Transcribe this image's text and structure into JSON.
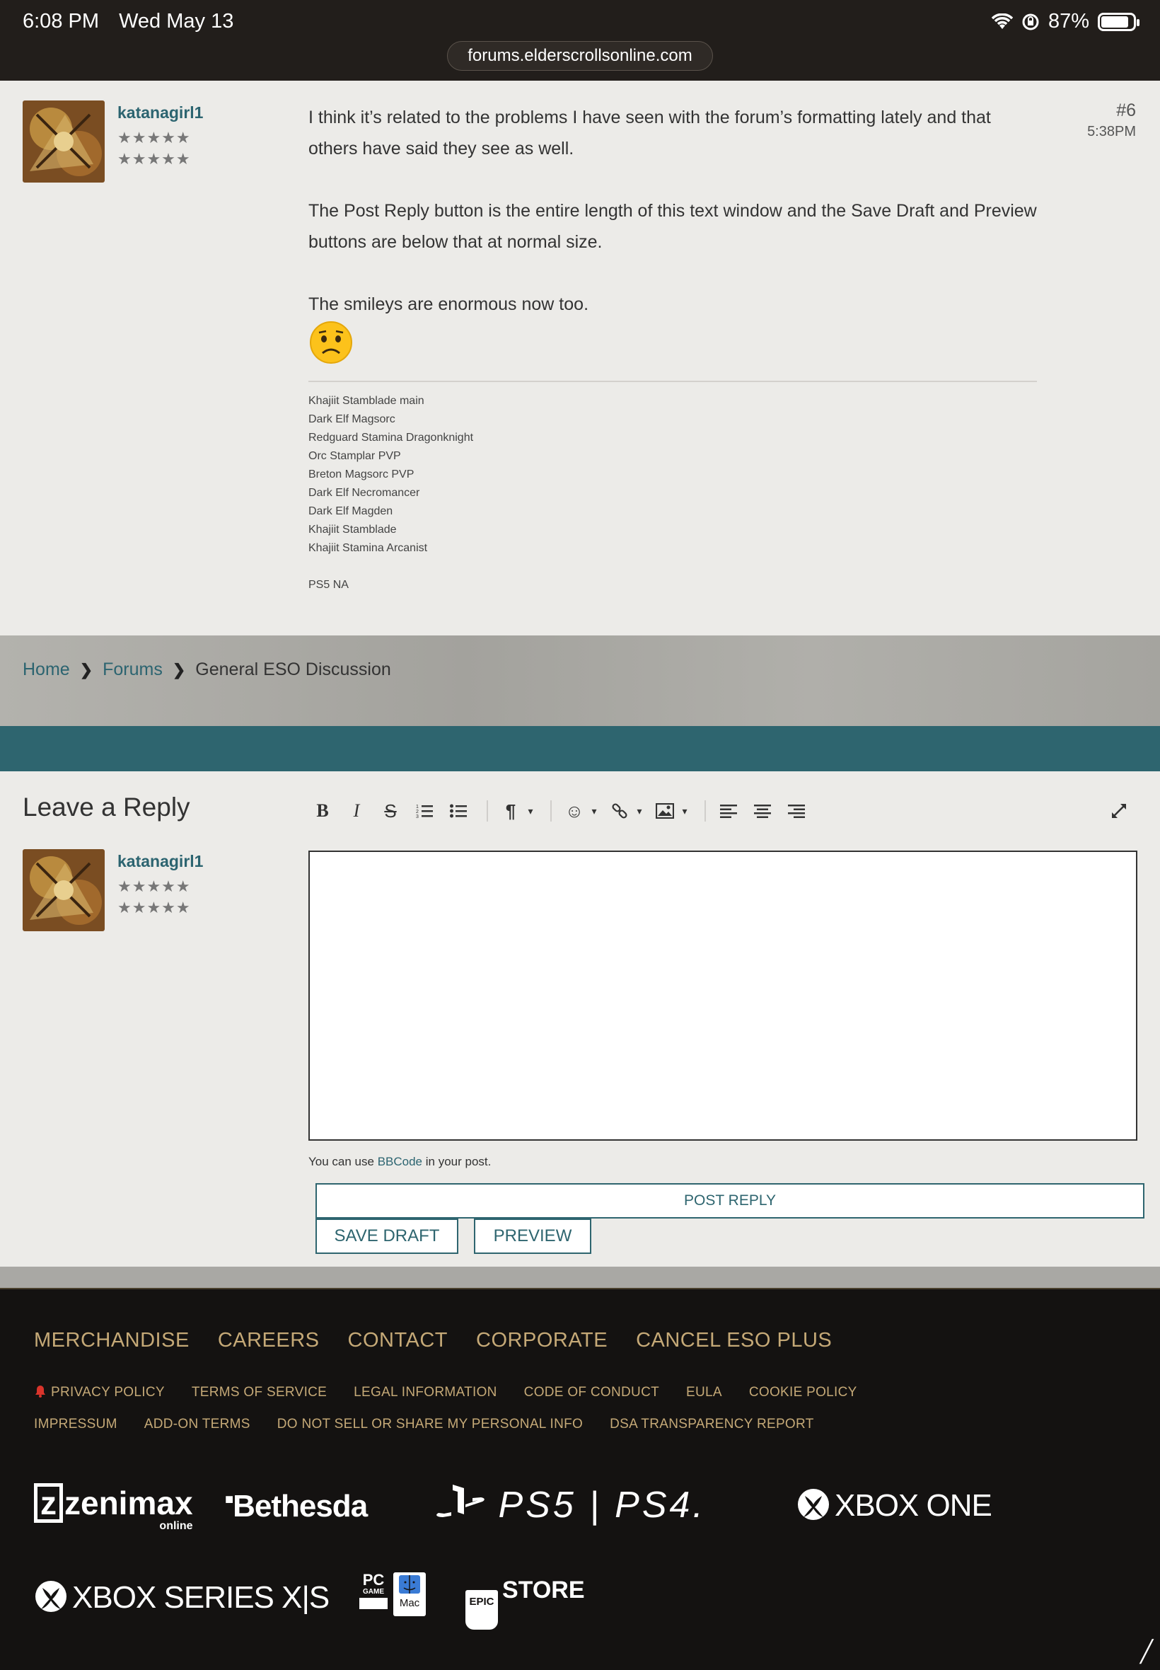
{
  "status_bar": {
    "time": "6:08 PM",
    "date": "Wed May 13",
    "battery": "87%",
    "url": "forums.elderscrollsonline.com",
    "battery_level": 0.87
  },
  "post": {
    "username": "katanagirl1",
    "stars_row1": "★★★★★",
    "stars_row2": "★★★★★",
    "number": "#6",
    "time": "5:38PM",
    "paragraphs": [
      "I think it’s related to the problems I have seen with the forum’s formatting lately and that others have said they see as well.",
      "The Post Reply button is the entire length of this text window and the Save Draft and Preview buttons are below that at normal size.",
      "The smileys are enormous now too."
    ],
    "signature": [
      "Khajiit Stamblade main",
      "Dark Elf Magsorc",
      "Redguard Stamina Dragonknight",
      "Orc Stamplar PVP",
      "Breton Magsorc PVP",
      "Dark Elf Necromancer",
      "Dark Elf Magden",
      "Khajiit Stamblade",
      "Khajiit Stamina Arcanist"
    ],
    "signature_platform": "PS5 NA"
  },
  "breadcrumb": {
    "home": "Home",
    "forums": "Forums",
    "current": "General ESO Discussion"
  },
  "reply": {
    "title": "Leave a Reply",
    "username": "katanagirl1",
    "stars_row1": "★★★★★",
    "stars_row2": "★★★★★",
    "hint_prefix": "You can use ",
    "hint_link": "BBCode",
    "hint_suffix": " in your post.",
    "post_reply": "POST REPLY",
    "save_draft": "SAVE DRAFT",
    "preview": "PREVIEW"
  },
  "toolbar": {
    "bold": "B",
    "italic": "I",
    "strike": "S",
    "ordered_list": "⒈",
    "unordered_list": "☰",
    "paragraph": "¶",
    "caret": "▾",
    "emoji": "☺",
    "link": "🔗",
    "image": "▣",
    "align_left": "≡",
    "align_center": "≡",
    "align_right": "≡",
    "fullscreen": "⤢"
  },
  "footer": {
    "nav": [
      "MERCHANDISE",
      "CAREERS",
      "CONTACT",
      "CORPORATE",
      "CANCEL ESO PLUS"
    ],
    "links": [
      "PRIVACY POLICY",
      "TERMS OF SERVICE",
      "LEGAL INFORMATION",
      "CODE OF CONDUCT",
      "EULA",
      "COOKIE POLICY",
      "IMPRESSUM",
      "ADD-ON TERMS",
      "DO NOT SELL OR SHARE MY PERSONAL INFO",
      "DSA TRANSPARENCY REPORT"
    ],
    "logos": {
      "zenimax": "zenimax",
      "zenimax_sub": "online",
      "bethesda": "Bethesda",
      "playstation": "PS5 | PS4.",
      "xbox_one": "XBOX ONE",
      "xbox_series": "XBOX SERIES X|S",
      "pc": "PC",
      "pc_sub": "GAME",
      "mac": "Mac",
      "epic": "EPIC",
      "store": "STORE"
    }
  },
  "colors": {
    "accent_teal": "#2e656f",
    "footer_gold": "#c5a977",
    "footer_bg": "#141211"
  }
}
